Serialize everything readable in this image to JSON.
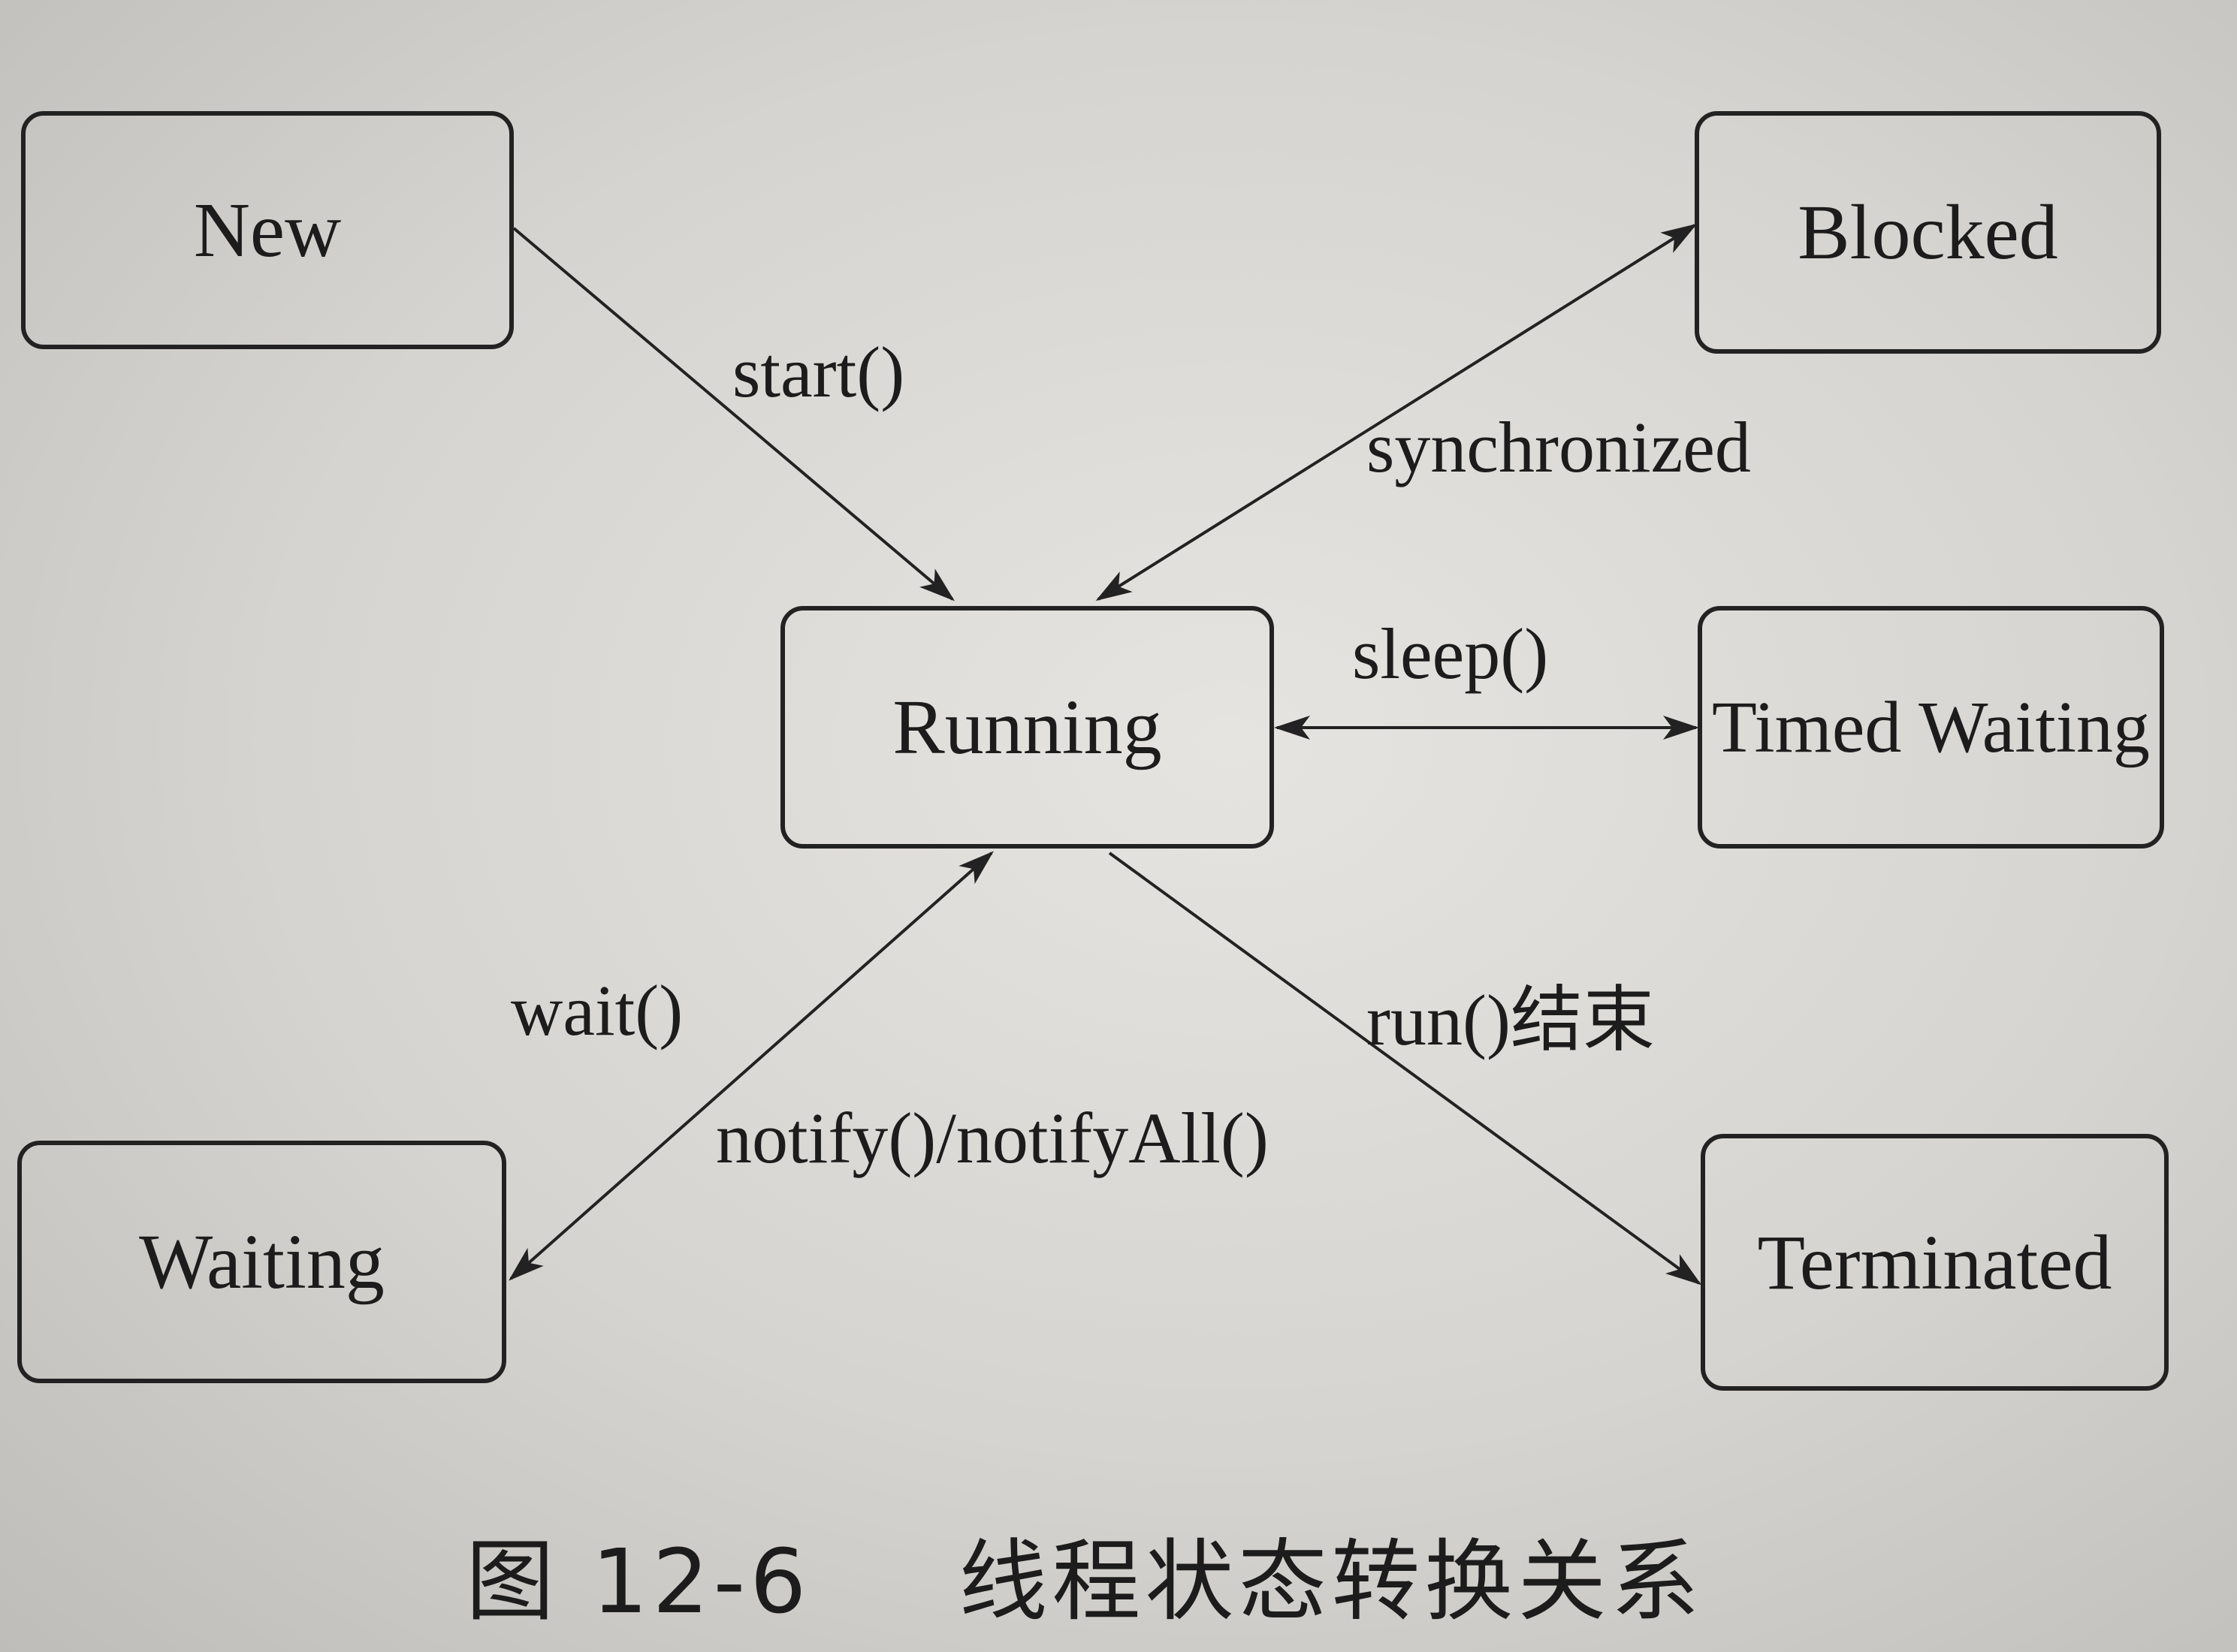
{
  "states": {
    "new": "New",
    "blocked": "Blocked",
    "running": "Running",
    "timed_waiting": "Timed Waiting",
    "waiting": "Waiting",
    "terminated": "Terminated"
  },
  "transitions": {
    "start": "start()",
    "synchronized": "synchronized",
    "sleep": "sleep()",
    "run_end": "run()结束",
    "wait": "wait()",
    "notify": "notify()/notifyAll()"
  },
  "caption": {
    "figure_number": "图 12-6",
    "title": "线程状态转换关系"
  }
}
